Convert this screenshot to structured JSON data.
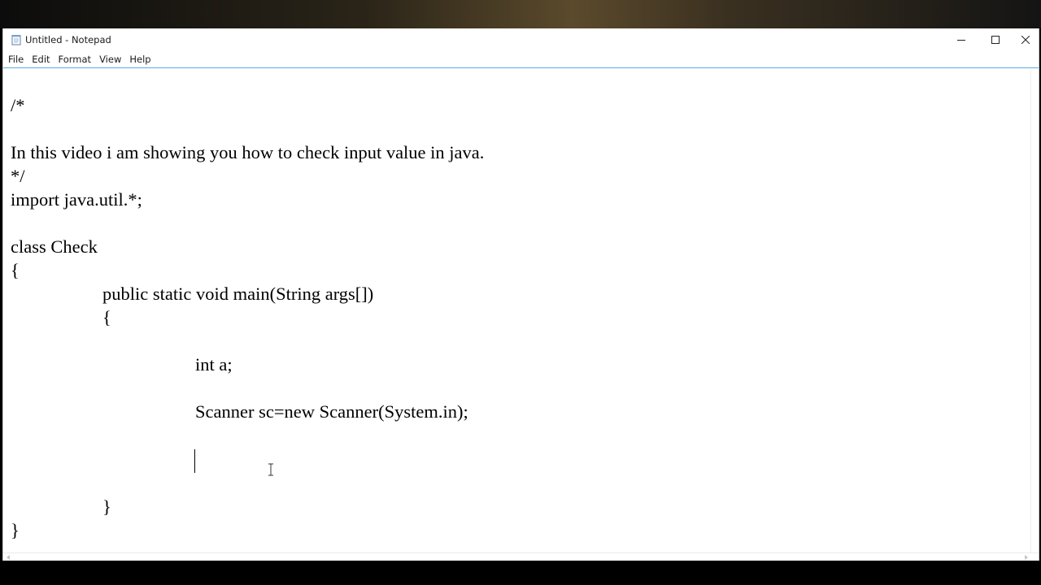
{
  "window": {
    "title": "Untitled - Notepad",
    "accent_color": "#5ea9e0"
  },
  "menu": {
    "items": [
      "File",
      "Edit",
      "Format",
      "View",
      "Help"
    ]
  },
  "editor": {
    "lines": [
      "/*",
      "",
      "In this video i am showing you how to check input value in java.",
      "*/",
      "import java.util.*;",
      "",
      "class Check",
      "{",
      "public static void main(String args[])",
      "{",
      "",
      "int a;",
      "",
      "Scanner sc=new Scanner(System.in);",
      "",
      "",
      "}",
      "}"
    ]
  }
}
